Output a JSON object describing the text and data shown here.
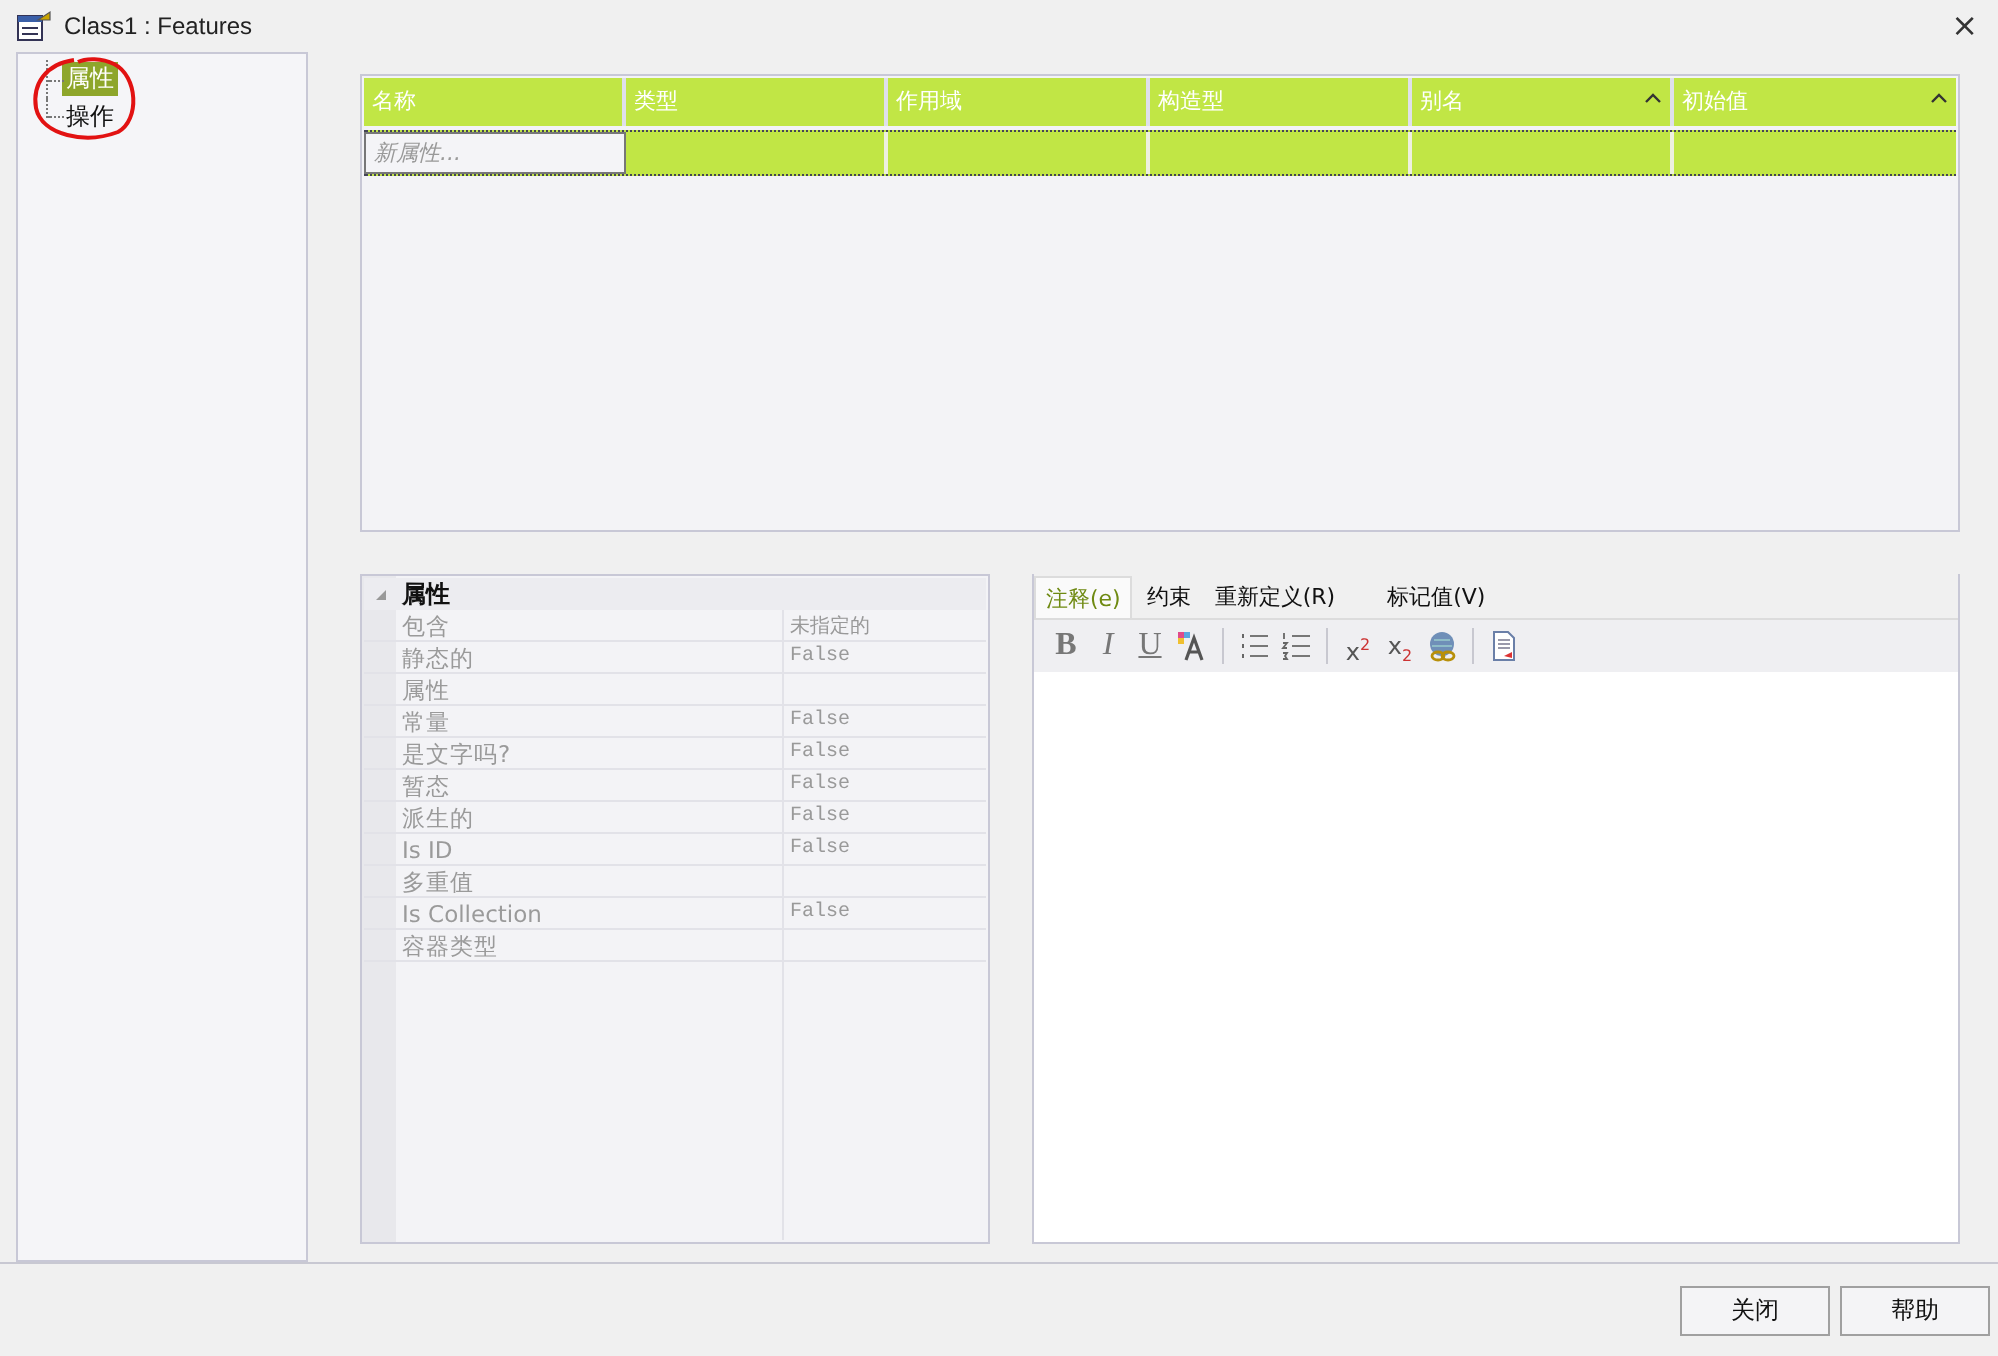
{
  "window": {
    "title": "Class1 : Features",
    "close": "×"
  },
  "tree": {
    "items": [
      {
        "label": "属性",
        "selected": true
      },
      {
        "label": "操作",
        "selected": false
      }
    ]
  },
  "table": {
    "columns": [
      {
        "label": "名称",
        "sort": false
      },
      {
        "label": "类型",
        "sort": false
      },
      {
        "label": "作用域",
        "sort": false
      },
      {
        "label": "构造型",
        "sort": false
      },
      {
        "label": "别名",
        "sort": true
      },
      {
        "label": "初始值",
        "sort": true
      }
    ],
    "new_row": {
      "placeholder": "新属性..."
    }
  },
  "properties": {
    "group": {
      "label": "属性",
      "expanded": true
    },
    "rows": [
      {
        "name": "包含",
        "value": "未指定的"
      },
      {
        "name": "静态的",
        "value": "False"
      },
      {
        "name": "属性"
      },
      {
        "name": "常量",
        "value": "False"
      },
      {
        "name": "是文字吗?",
        "value": "False"
      },
      {
        "name": "暂态",
        "value": "False"
      },
      {
        "name": "派生的",
        "value": "False"
      },
      {
        "name": "Is ID",
        "value": "False"
      },
      {
        "name": "多重值"
      },
      {
        "name": "Is Collection",
        "value": "False"
      },
      {
        "name": "容器类型"
      }
    ]
  },
  "notes": {
    "tabs": [
      {
        "label": "注释(e)",
        "selected": true
      },
      {
        "label": "约束",
        "selected": false
      },
      {
        "label": "重新定义(R)",
        "selected": false
      },
      {
        "label": "标记值(V)",
        "selected": false
      }
    ],
    "toolbar": [
      {
        "kind": "bold",
        "label": "B"
      },
      {
        "kind": "italic",
        "label": "I"
      },
      {
        "kind": "underline",
        "label": "U"
      },
      {
        "kind": "font-color"
      },
      {
        "kind": "separator"
      },
      {
        "kind": "bullets"
      },
      {
        "kind": "numbering"
      },
      {
        "kind": "separator"
      },
      {
        "kind": "script",
        "label": "x$^{2}$"
      },
      {
        "kind": "script",
        "label": "x$_{2}$"
      },
      {
        "kind": "link"
      },
      {
        "kind": "separator"
      },
      {
        "kind": "document"
      }
    ]
  },
  "buttons": [
    "关闭",
    "帮助"
  ]
}
